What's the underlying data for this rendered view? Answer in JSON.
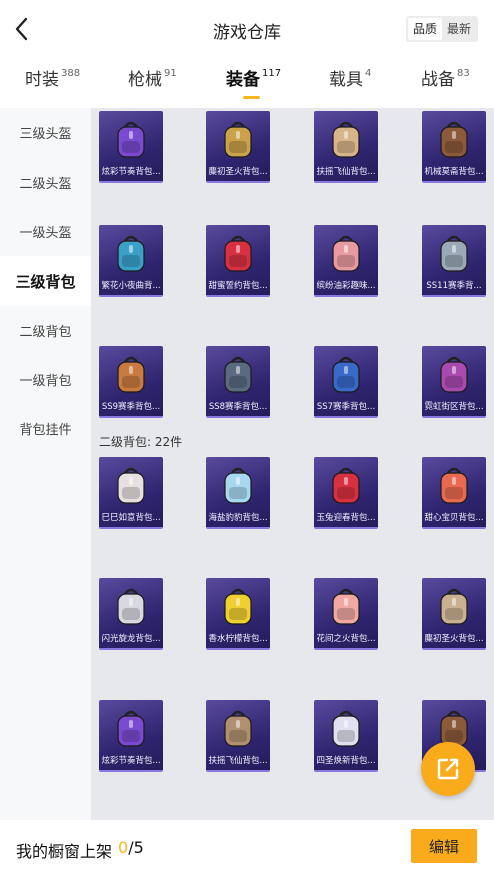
{
  "header": {
    "title": "游戏仓库",
    "sort_options": [
      {
        "label": "品质",
        "active": true
      },
      {
        "label": "最新",
        "active": false
      }
    ]
  },
  "tabs": [
    {
      "label": "时装",
      "count": "388",
      "active": false
    },
    {
      "label": "枪械",
      "count": "91",
      "active": false
    },
    {
      "label": "装备",
      "count": "117",
      "active": true
    },
    {
      "label": "载具",
      "count": "4",
      "active": false
    },
    {
      "label": "战备",
      "count": "83",
      "active": false
    }
  ],
  "sidebar": {
    "items": [
      {
        "label": "三级头盔",
        "active": false
      },
      {
        "label": "二级头盔",
        "active": false
      },
      {
        "label": "一级头盔",
        "active": false
      },
      {
        "label": "三级背包",
        "active": true
      },
      {
        "label": "二级背包",
        "active": false
      },
      {
        "label": "一级背包",
        "active": false
      },
      {
        "label": "背包挂件",
        "active": false
      }
    ]
  },
  "level3_items": [
    {
      "name": "炫彩节奏背包...",
      "icon": "backpack-icon",
      "color": "#7a4ad0"
    },
    {
      "name": "麋初圣火背包...",
      "icon": "backpack-icon",
      "color": "#c9a24a"
    },
    {
      "name": "扶摇飞仙背包...",
      "icon": "backpack-icon",
      "color": "#d8b48a"
    },
    {
      "name": "机械莫斋背包...",
      "icon": "backpack-icon",
      "color": "#8a5a3a"
    },
    {
      "name": "繁花小夜曲背...",
      "icon": "backpack-icon",
      "color": "#3aa0c8"
    },
    {
      "name": "甜蜜誓约背包...",
      "icon": "backpack-icon",
      "color": "#d83040"
    },
    {
      "name": "缤纷油彩趣味...",
      "icon": "backpack-icon",
      "color": "#e89aa0"
    },
    {
      "name": "SS11赛季背...",
      "icon": "backpack-icon",
      "color": "#9aa8b8"
    },
    {
      "name": "SS9赛季背包...",
      "icon": "backpack-icon",
      "color": "#c87a40"
    },
    {
      "name": "SS8赛季背包...",
      "icon": "backpack-icon",
      "color": "#5a6a80"
    },
    {
      "name": "SS7赛季背包...",
      "icon": "backpack-icon",
      "color": "#3a6ac8"
    },
    {
      "name": "霓虹街区背包...",
      "icon": "backpack-icon",
      "color": "#a84ab0"
    }
  ],
  "level2_section_label": "二级背包: 22件",
  "level2_items": [
    {
      "name": "巳巳如意背包...",
      "icon": "backpack-icon",
      "color": "#e8e0e0"
    },
    {
      "name": "海盐豹豹背包...",
      "icon": "backpack-icon",
      "color": "#a8d8f0"
    },
    {
      "name": "玉兔迎春背包...",
      "icon": "backpack-icon",
      "color": "#d83040"
    },
    {
      "name": "甜心宝贝背包...",
      "icon": "backpack-icon",
      "color": "#e86a50"
    },
    {
      "name": "闪光旋龙背包...",
      "icon": "backpack-icon",
      "color": "#d8d8e0"
    },
    {
      "name": "香水柠檬背包...",
      "icon": "backpack-icon",
      "color": "#f0d030"
    },
    {
      "name": "花间之火背包...",
      "icon": "backpack-icon",
      "color": "#f0a8a0"
    },
    {
      "name": "麋初圣火背包...",
      "icon": "backpack-icon",
      "color": "#c8b090"
    },
    {
      "name": "炫彩节奏背包...",
      "icon": "backpack-icon",
      "color": "#7a4ad0"
    },
    {
      "name": "扶摇飞仙背包...",
      "icon": "backpack-icon",
      "color": "#b09070"
    },
    {
      "name": "四圣焕新背包...",
      "icon": "backpack-icon",
      "color": "#e0e0f0"
    },
    {
      "name": "",
      "icon": "backpack-icon",
      "color": "#8a5a3a"
    }
  ],
  "footer": {
    "showcase_label": "我的橱窗上架",
    "showcase_current": "0",
    "showcase_total": "/5",
    "edit_label": "编辑"
  },
  "colors": {
    "accent": "#f9ab1c",
    "card": "#2f2570"
  }
}
